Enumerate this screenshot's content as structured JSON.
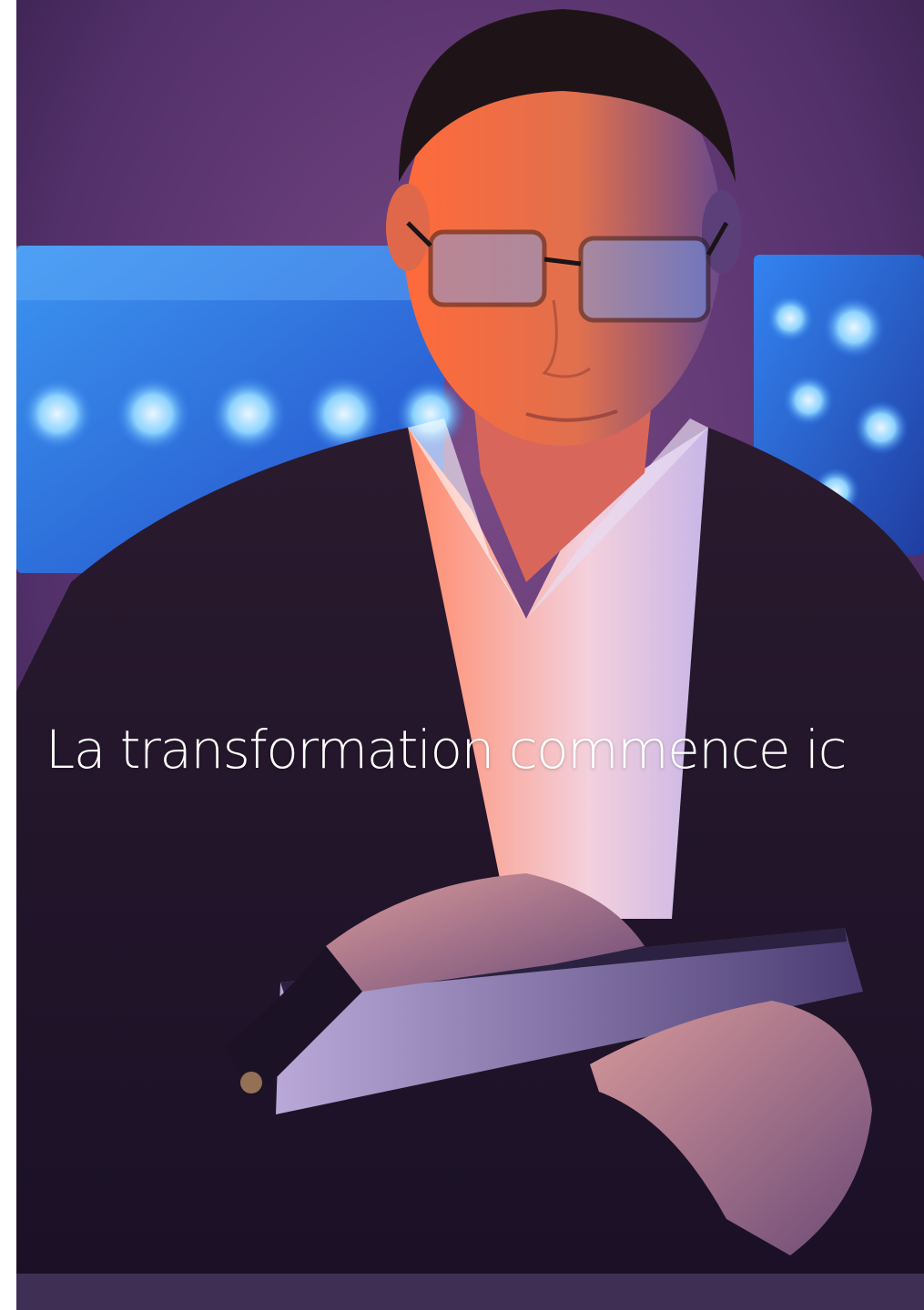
{
  "hero": {
    "heading": "La transformation commence ic",
    "photo_icon": "person-with-tablet-photo"
  }
}
